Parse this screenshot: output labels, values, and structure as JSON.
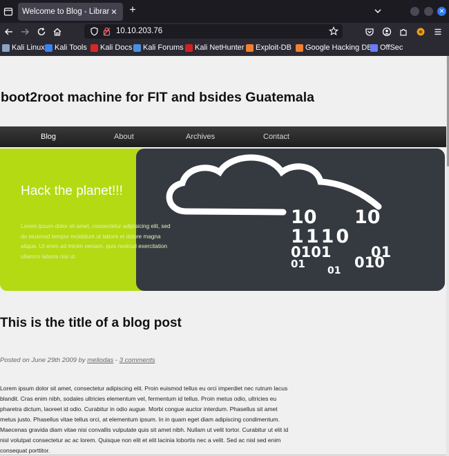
{
  "browser": {
    "tab_title": "Welcome to Blog - Library M",
    "new_tab_label": "+",
    "url": "10.10.203.76",
    "bookmarks": [
      {
        "label": "Kali Linux",
        "color": "#8aa4c8"
      },
      {
        "label": "Kali Tools",
        "color": "#3b82f6"
      },
      {
        "label": "Kali Docs",
        "color": "#dc2626"
      },
      {
        "label": "Kali Forums",
        "color": "#4a90e2"
      },
      {
        "label": "Kali NetHunter",
        "color": "#d12020"
      },
      {
        "label": "Exploit-DB",
        "color": "#f08030"
      },
      {
        "label": "Google Hacking DB",
        "color": "#f08030"
      },
      {
        "label": "OffSec",
        "color": "#6a7cff"
      }
    ]
  },
  "site": {
    "title": "boot2root machine for FIT and bsides Guatemala",
    "menu": [
      "Blog",
      "About",
      "Archives",
      "Contact"
    ]
  },
  "hero": {
    "heading": "Hack the planet!!!",
    "text": "Lorem ipsum dolor sit amet, consectetur adipisicing elit, sed do eiusmod tempor incididunt ut labore et dolore magna aliqua. Ut enim ad minim veniam, quis nostrud exercitation ullamco laboris nisi ut.",
    "binary": [
      "10",
      "10",
      "1110",
      "0101",
      "01",
      "01",
      "010",
      "01"
    ],
    "colors": {
      "lime": "#b3da12",
      "dark": "#353a41"
    }
  },
  "post": {
    "title": "This is the title of a blog post",
    "meta_prefix": "Posted on June 29th 2009 by ",
    "author": "meliodas",
    "meta_sep": " - ",
    "comments": "3 comments",
    "body": "Lorem ipsum dolor sit amet, consectetur adipiscing elit. Proin euismod tellus eu orci imperdiet nec rutrum lacus blandit. Cras enim nibh, sodales ultricies elementum vel, fermentum id tellus. Proin metus odio, ultricies eu pharetra dictum, laoreet id odio. Curabitur in odio augue. Morbi congue auctor interdum. Phasellus sit amet metus justo. Phasellus vitae tellus orci, at elementum ipsum. In in quam eget diam adipiscing condimentum. Maecenas gravida diam vitae nisi convallis vulputate quis sit amet nibh. Nullam ut velit tortor. Curabitur ut elit id nisl volutpat consectetur ac ac lorem. Quisque non elit et elit lacinia lobortis nec a velit. Sed ac nisl sed enim consequat porttitor."
  }
}
